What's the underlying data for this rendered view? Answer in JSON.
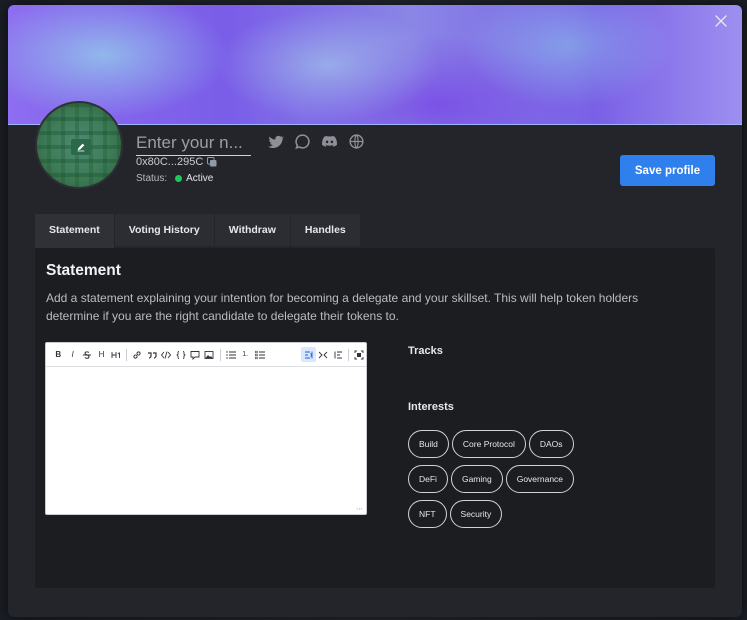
{
  "profile": {
    "name_placeholder": "Enter your n...",
    "address": "0x80C...295C",
    "status_label": "Status:",
    "status_value": "Active",
    "status_color": "#22c55e",
    "socials": [
      "twitter-icon",
      "discourse-icon",
      "discord-icon",
      "website-globe-icon"
    ]
  },
  "actions": {
    "save_label": "Save profile",
    "save_color": "#2f80ed"
  },
  "tabs": [
    {
      "label": "Statement",
      "active": true
    },
    {
      "label": "Voting History",
      "active": false
    },
    {
      "label": "Withdraw",
      "active": false
    },
    {
      "label": "Handles",
      "active": false
    }
  ],
  "statement": {
    "title": "Statement",
    "description": "Add a statement explaining your intention for becoming a delegate and your skillset. This will help token holders determine if you are the right candidate to delegate their tokens to.",
    "editor_value": ""
  },
  "editor_toolbar": {
    "bold": "B",
    "italic": "I",
    "heading": "H",
    "ordered_list": "1."
  },
  "tracks": {
    "label": "Tracks"
  },
  "interests": {
    "label": "Interests",
    "rows": [
      [
        "Build",
        "Core Protocol",
        "DAOs"
      ],
      [
        "DeFi",
        "Gaming",
        "Governance"
      ],
      [
        "NFT",
        "Security"
      ]
    ]
  }
}
